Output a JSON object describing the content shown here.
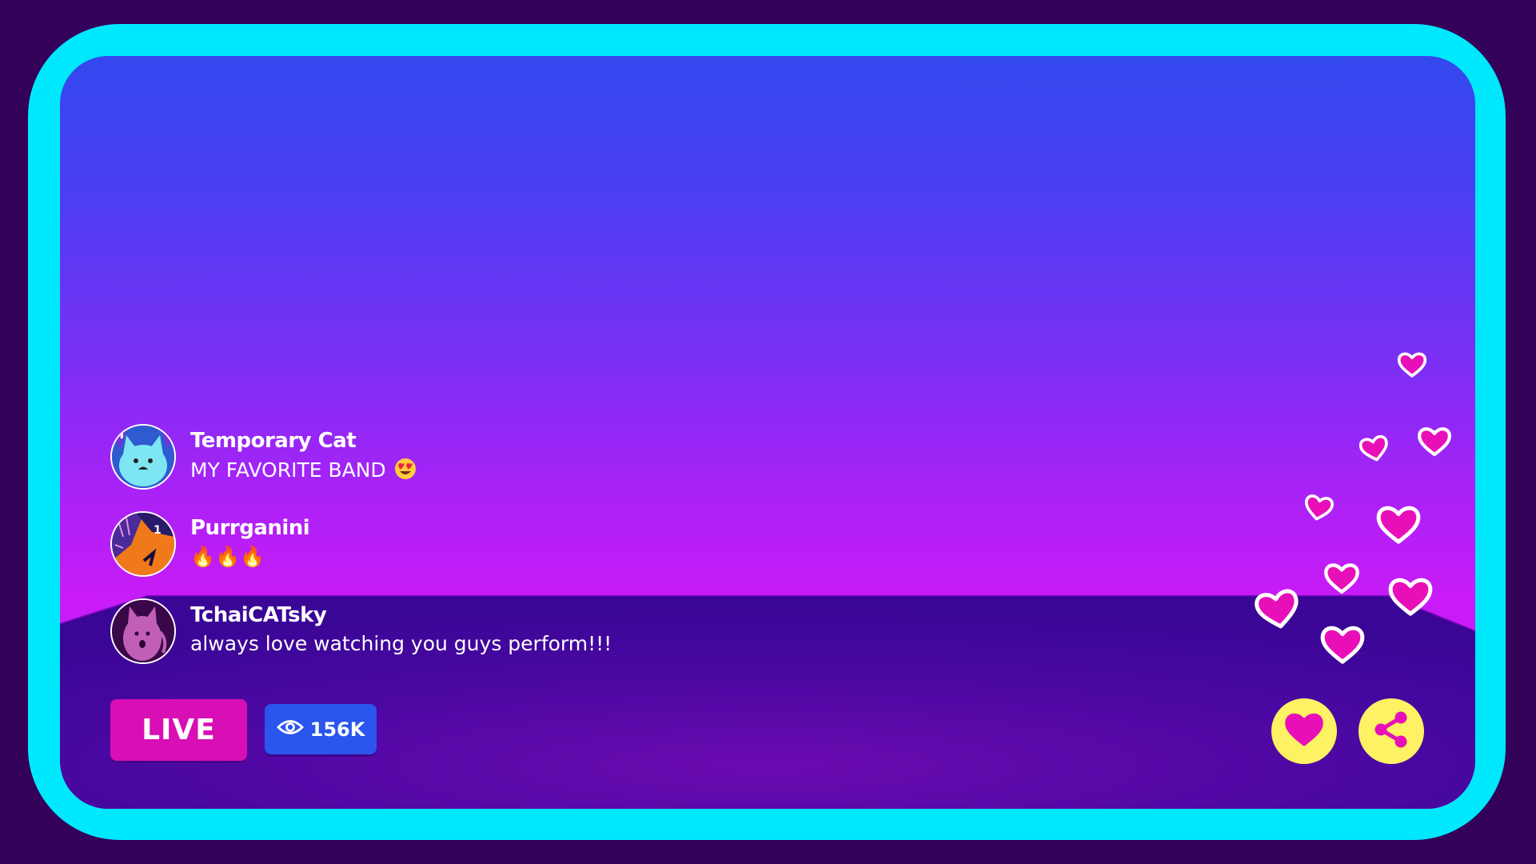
{
  "chat": {
    "messages": [
      {
        "user": "Temporary Cat",
        "text": "MY FAVORITE BAND",
        "emoji": "heart-eyes-emoji"
      },
      {
        "user": "Purrganini",
        "text": "🔥🔥🔥"
      },
      {
        "user": "TchaiCATsky",
        "text": "always love watching you guys perform!!!"
      }
    ]
  },
  "status": {
    "live_label": "LIVE",
    "viewer_count": "156K"
  },
  "actions": {
    "like_icon": "heart-icon",
    "share_icon": "share-icon"
  },
  "colors": {
    "frame": "#00e8fb",
    "background": "#33005a",
    "live": "#d80fb5",
    "viewers": "#2a55ee",
    "action_button": "#fdf263",
    "heart": "#e80fb8"
  }
}
